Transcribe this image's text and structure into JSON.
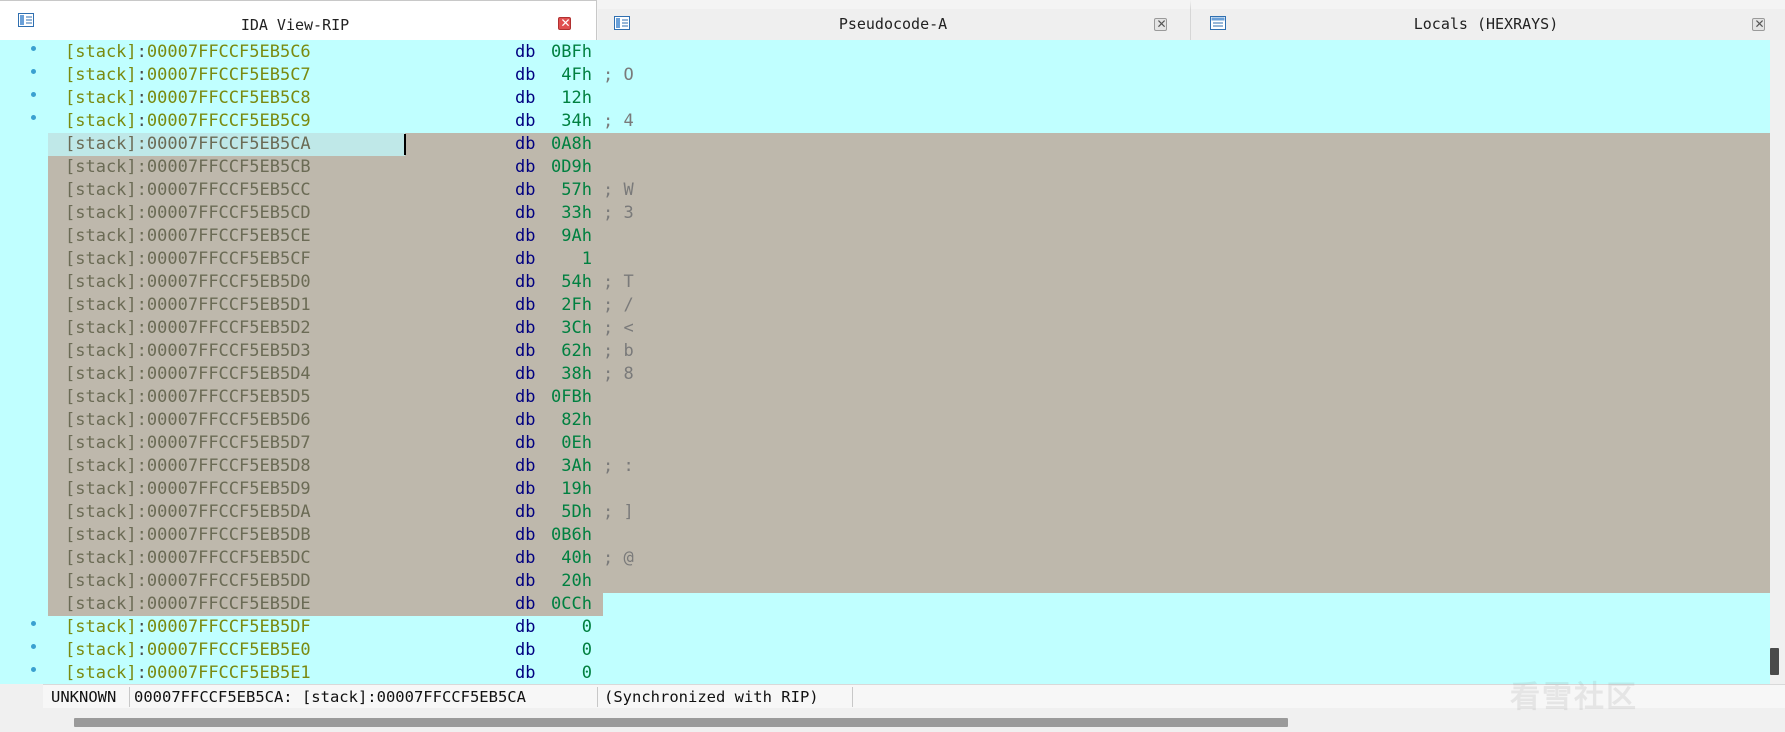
{
  "tabs": [
    {
      "title": "IDA View-RIP",
      "active": true,
      "close_icon": "close-red-icon"
    },
    {
      "title": "Pseudocode-A",
      "active": false,
      "close_icon": "close-gray-icon"
    },
    {
      "title": "Locals (HEXRAYS)",
      "active": false,
      "close_icon": "close-gray-icon"
    }
  ],
  "listing": {
    "segment": "[stack]",
    "mnemonic": "db",
    "rows": [
      {
        "addr": "00007FFCCF5EB5C6",
        "value": "0BFh",
        "comment": ""
      },
      {
        "addr": "00007FFCCF5EB5C7",
        "value": "4Fh",
        "comment": "; O"
      },
      {
        "addr": "00007FFCCF5EB5C8",
        "value": "12h",
        "comment": ""
      },
      {
        "addr": "00007FFCCF5EB5C9",
        "value": "34h",
        "comment": "; 4"
      },
      {
        "addr": "00007FFCCF5EB5CA",
        "value": "0A8h",
        "comment": ""
      },
      {
        "addr": "00007FFCCF5EB5CB",
        "value": "0D9h",
        "comment": ""
      },
      {
        "addr": "00007FFCCF5EB5CC",
        "value": "57h",
        "comment": "; W"
      },
      {
        "addr": "00007FFCCF5EB5CD",
        "value": "33h",
        "comment": "; 3"
      },
      {
        "addr": "00007FFCCF5EB5CE",
        "value": "9Ah",
        "comment": ""
      },
      {
        "addr": "00007FFCCF5EB5CF",
        "value": "1",
        "comment": ""
      },
      {
        "addr": "00007FFCCF5EB5D0",
        "value": "54h",
        "comment": "; T"
      },
      {
        "addr": "00007FFCCF5EB5D1",
        "value": "2Fh",
        "comment": "; /"
      },
      {
        "addr": "00007FFCCF5EB5D2",
        "value": "3Ch",
        "comment": "; <"
      },
      {
        "addr": "00007FFCCF5EB5D3",
        "value": "62h",
        "comment": "; b"
      },
      {
        "addr": "00007FFCCF5EB5D4",
        "value": "38h",
        "comment": "; 8"
      },
      {
        "addr": "00007FFCCF5EB5D5",
        "value": "0FBh",
        "comment": ""
      },
      {
        "addr": "00007FFCCF5EB5D6",
        "value": "82h",
        "comment": ""
      },
      {
        "addr": "00007FFCCF5EB5D7",
        "value": "0Eh",
        "comment": ""
      },
      {
        "addr": "00007FFCCF5EB5D8",
        "value": "3Ah",
        "comment": "; :"
      },
      {
        "addr": "00007FFCCF5EB5D9",
        "value": "19h",
        "comment": ""
      },
      {
        "addr": "00007FFCCF5EB5DA",
        "value": "5Dh",
        "comment": "; ]"
      },
      {
        "addr": "00007FFCCF5EB5DB",
        "value": "0B6h",
        "comment": ""
      },
      {
        "addr": "00007FFCCF5EB5DC",
        "value": "40h",
        "comment": "; @"
      },
      {
        "addr": "00007FFCCF5EB5DD",
        "value": "20h",
        "comment": ""
      },
      {
        "addr": "00007FFCCF5EB5DE",
        "value": "0CCh",
        "comment": ""
      },
      {
        "addr": "00007FFCCF5EB5DF",
        "value": "0",
        "comment": ""
      },
      {
        "addr": "00007FFCCF5EB5E0",
        "value": "0",
        "comment": ""
      },
      {
        "addr": "00007FFCCF5EB5E1",
        "value": "0",
        "comment": ""
      }
    ],
    "selection_start": 4,
    "selection_end": 24,
    "cursor_row": 4
  },
  "status": {
    "type": "UNKNOWN",
    "location": "00007FFCCF5EB5CA: [stack]:00007FFCCF5EB5CA",
    "sync": "(Synchronized with RIP)"
  },
  "colors": {
    "listing_bg": "#c0ffff",
    "selection_bg": "#beb8ac",
    "address_color": "#7a8a10",
    "mnemonic_color": "#000080",
    "value_color": "#008040"
  },
  "watermark": "看雪社区"
}
